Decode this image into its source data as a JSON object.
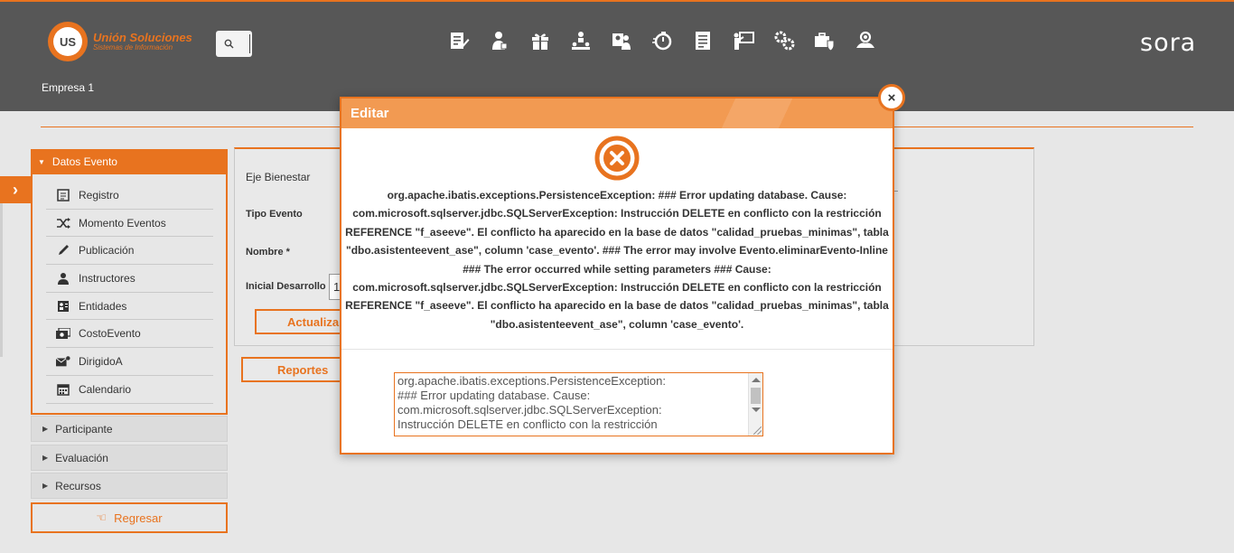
{
  "header": {
    "logo_mark": "US",
    "logo_title": "Unión Soluciones",
    "logo_subtitle": "Sistemas de Información",
    "brand": "sora",
    "empresa": "Empresa 1",
    "nav_icons": [
      "document-edit-icon",
      "user-person-icon",
      "gift-icon",
      "hierarchy-icon",
      "user-card-icon",
      "stopwatch-icon",
      "list-document-icon",
      "presentation-icon",
      "gears-icon",
      "briefcase-shield-icon",
      "medal-group-icon"
    ]
  },
  "menu": {
    "datos_evento": "Datos Evento",
    "items": [
      {
        "label": "Registro",
        "icon": "registro-icon"
      },
      {
        "label": "Momento Eventos",
        "icon": "shuffle-icon"
      },
      {
        "label": "Publicación",
        "icon": "pen-icon"
      },
      {
        "label": "Instructores",
        "icon": "user-icon"
      },
      {
        "label": "Entidades",
        "icon": "entity-icon"
      },
      {
        "label": "CostoEvento",
        "icon": "money-icon"
      },
      {
        "label": "DirigidoA",
        "icon": "mail-icon"
      },
      {
        "label": "Calendario",
        "icon": "calendar-icon"
      }
    ],
    "participante": "Participante",
    "evaluacion": "Evaluación",
    "recursos": "Recursos",
    "regresar": "Regresar"
  },
  "form": {
    "eje_bienestar": "Eje Bienestar",
    "tipo_evento": "Tipo Evento",
    "nombre": "Nombre *",
    "inicial_desarrollo": "Inicial Desarrollo",
    "inicial_value": "1",
    "actualizar": "Actualiza",
    "reportes": "Reportes"
  },
  "modal": {
    "title": "Editar",
    "close": "×",
    "message": "org.apache.ibatis.exceptions.PersistenceException: ### Error updating database. Cause: com.microsoft.sqlserver.jdbc.SQLServerException: Instrucción DELETE en conflicto con la restricción REFERENCE \"f_aseeve\". El conflicto ha aparecido en la base de datos \"calidad_pruebas_minimas\", tabla \"dbo.asistenteevent_ase\", column 'case_evento'. ### The error may involve Evento.eliminarEvento-Inline ### The error occurred while setting parameters ### Cause: com.microsoft.sqlserver.jdbc.SQLServerException: Instrucción DELETE en conflicto con la restricción REFERENCE \"f_aseeve\". El conflicto ha aparecido en la base de datos \"calidad_pruebas_minimas\", tabla \"dbo.asistenteevent_ase\", column 'case_evento'.",
    "textarea_value": "org.apache.ibatis.exceptions.PersistenceException:\n### Error updating database.  Cause:\ncom.microsoft.sqlserver.jdbc.SQLServerException:\nInstrucción DELETE en conflicto con la restricción"
  },
  "colors": {
    "accent": "#e8731f",
    "header_bg": "#575757",
    "modal_head": "#f29a52"
  }
}
